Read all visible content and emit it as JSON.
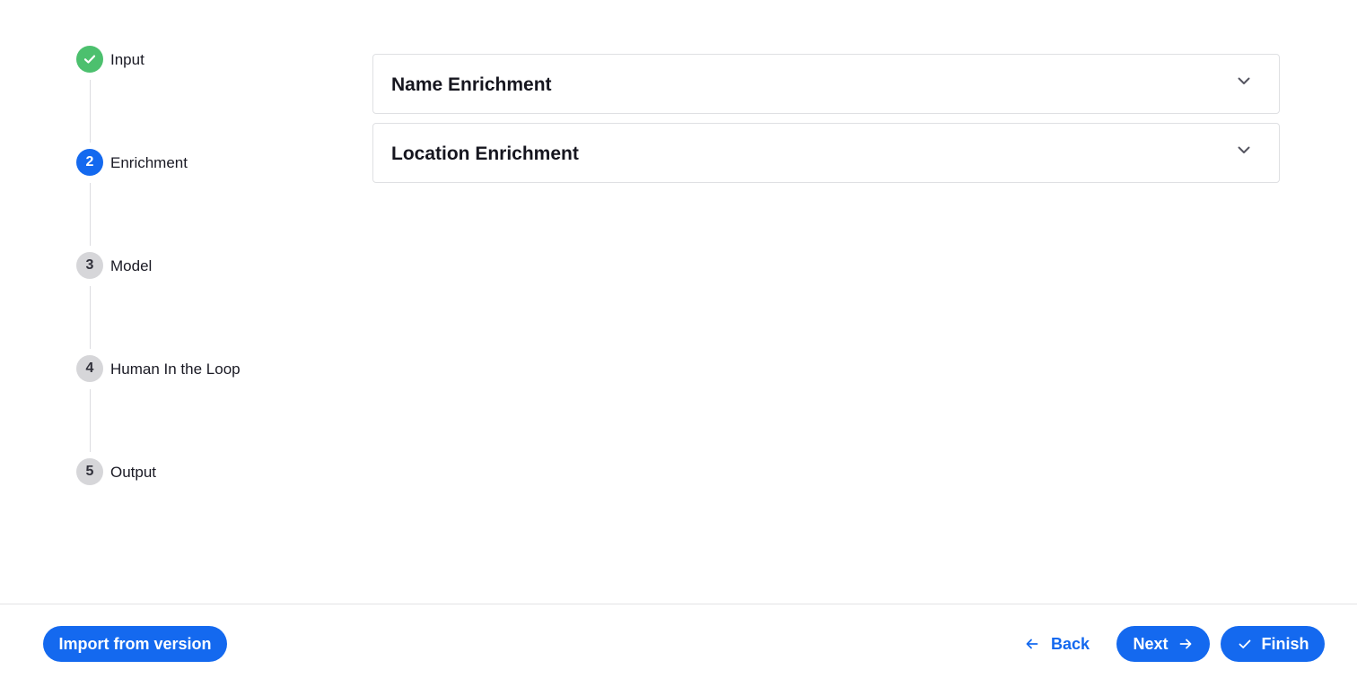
{
  "stepper": {
    "steps": [
      {
        "number": "",
        "label": "Input",
        "state": "done"
      },
      {
        "number": "2",
        "label": "Enrichment",
        "state": "active"
      },
      {
        "number": "3",
        "label": "Model",
        "state": "pending"
      },
      {
        "number": "4",
        "label": "Human In the Loop",
        "state": "pending"
      },
      {
        "number": "5",
        "label": "Output",
        "state": "pending"
      }
    ]
  },
  "accordions": [
    {
      "title": "Name Enrichment",
      "icon": "chevron-down-icon"
    },
    {
      "title": "Location Enrichment",
      "icon": "chevron-down-icon"
    }
  ],
  "footer": {
    "import_label": "Import from version",
    "back_label": "Back",
    "next_label": "Next",
    "finish_label": "Finish"
  },
  "colors": {
    "accent": "#1469ef",
    "success": "#4cc06e",
    "pending": "#d6d6d9"
  }
}
